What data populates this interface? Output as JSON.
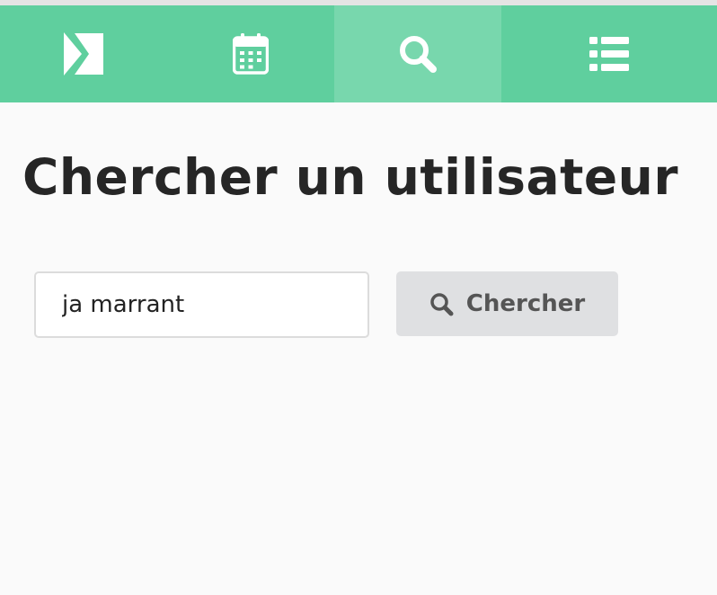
{
  "colors": {
    "navbar": "#5fcf9e",
    "navbar_active": "#78d7ad",
    "icon": "#ffffff",
    "background": "#fafafa",
    "title": "#262626",
    "button_bg": "#dfe0e2",
    "button_text": "#555555"
  },
  "nav": {
    "items": [
      {
        "icon": "logo-icon"
      },
      {
        "icon": "calendar-icon"
      },
      {
        "icon": "search-icon",
        "active": true
      },
      {
        "icon": "list-icon"
      }
    ]
  },
  "page": {
    "title": "Chercher un utilisateur"
  },
  "search": {
    "value": "ja marrant",
    "button_label": "Chercher",
    "button_icon": "search-icon"
  }
}
